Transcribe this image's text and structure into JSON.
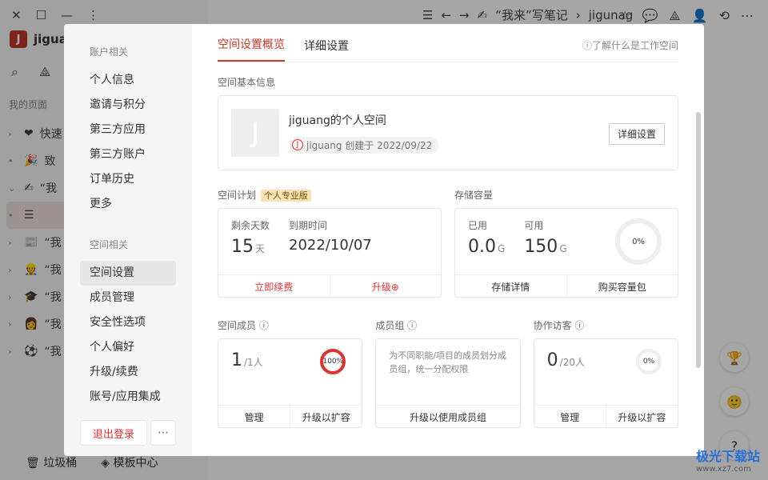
{
  "app": {
    "workspace_name": "jiguang",
    "workspace_initial": "J",
    "my_pages_label": "我的页面",
    "pages": [
      {
        "icon": "heart-icon",
        "glyph": "❤",
        "label": "快速"
      },
      {
        "icon": "party-icon",
        "glyph": "🎉",
        "label": "致"
      },
      {
        "icon": "pen-icon",
        "glyph": "✍",
        "label": "“我"
      },
      {
        "icon": "doc-icon",
        "glyph": "☰",
        "label": ""
      },
      {
        "icon": "news-icon",
        "glyph": "📰",
        "label": "“我"
      },
      {
        "icon": "person-icon",
        "glyph": "👷",
        "label": "“我"
      },
      {
        "icon": "cap-icon",
        "glyph": "🎓",
        "label": "“我"
      },
      {
        "icon": "woman-icon",
        "glyph": "👩",
        "label": "“我"
      },
      {
        "icon": "ball-icon",
        "glyph": "⚽",
        "label": "“我"
      }
    ],
    "trash_label": "垃圾桶",
    "templates_label": "模板中心",
    "breadcrumb": [
      "“我来”写笔记",
      "jigunag"
    ]
  },
  "modal": {
    "account_group": "账户相关",
    "account_items": [
      "个人信息",
      "邀请与积分",
      "第三方应用",
      "第三方账户",
      "订单历史",
      "更多"
    ],
    "space_group": "空间相关",
    "space_items": [
      "空间设置",
      "成员管理",
      "安全性选项",
      "个人偏好",
      "升级/续费",
      "账号/应用集成"
    ],
    "logout_label": "退出登录",
    "tabs": [
      "空间设置概览",
      "详细设置"
    ],
    "help_label": "了解什么是工作空间",
    "basic": {
      "title": "空间基本信息",
      "avatar_initial": "J",
      "name": "jiguang的个人空间",
      "created": "jiguang 创建于 2022/09/22",
      "detail_button": "详细设置"
    },
    "plan": {
      "title": "空间计划",
      "badge": "个人专业版",
      "remaining_label": "剩余天数",
      "remaining_value": "15",
      "remaining_unit": "天",
      "expire_label": "到期时间",
      "expire_value": "2022/10/07",
      "renew": "立即续费",
      "upgrade": "升级"
    },
    "storage": {
      "title": "存储容量",
      "used_label": "已用",
      "used_value": "0.0",
      "used_unit": "G",
      "avail_label": "可用",
      "avail_value": "150",
      "avail_unit": "G",
      "percent": "0%",
      "detail": "存储详情",
      "buy": "购买容量包"
    },
    "members": {
      "title": "空间成员",
      "value": "1",
      "unit": "/1人",
      "percent": "100%",
      "manage": "管理",
      "upgrade": "升级以扩容"
    },
    "groups": {
      "title": "成员组",
      "desc": "为不同职能/项目的成员划分成员组，统一分配权限",
      "action": "升级以使用成员组"
    },
    "guests": {
      "title": "协作访客",
      "value": "0",
      "unit": "/20人",
      "percent": "0%",
      "manage": "管理",
      "upgrade": "升级以扩容"
    }
  },
  "watermark": {
    "title": "极光下载站",
    "url": "www.xz7.com"
  },
  "colors": {
    "accent": "#c0392b",
    "badge_bg": "#f7e1b5"
  }
}
